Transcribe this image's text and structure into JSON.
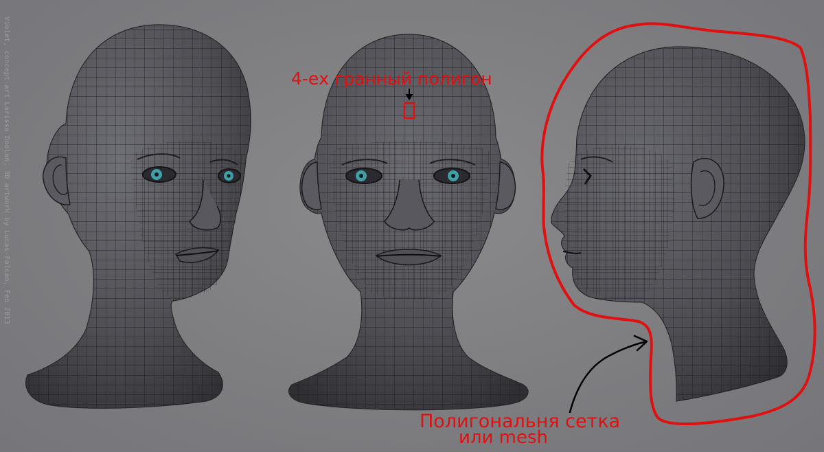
{
  "credit": "Violet, concept art Larissa Doolan, 3D artwork by Lucas Falcao, Feb 2013",
  "annotations": {
    "quad_label": "4-ех гранный полигон",
    "mesh_label_line1": "Полигональня сетка",
    "mesh_label_line2": "или mesh"
  },
  "colors": {
    "background": "#7d7d80",
    "annotation": "#e01010",
    "head_fill": "#4f4f55",
    "wire": "#17171a",
    "iris": "#3fa0a8"
  },
  "views": [
    "three-quarter",
    "front",
    "profile"
  ]
}
